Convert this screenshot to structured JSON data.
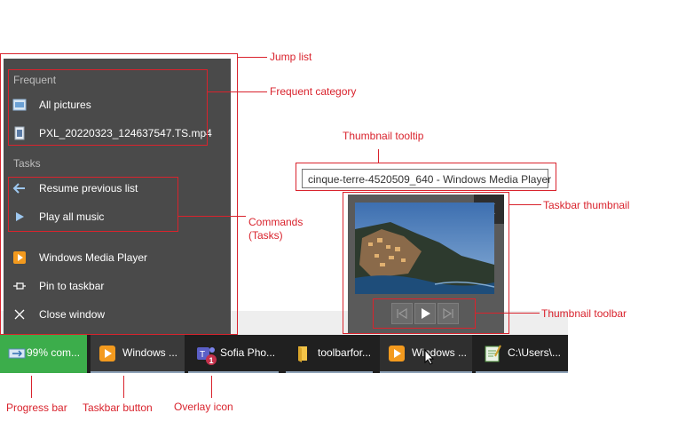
{
  "jump_list": {
    "frequent_header": "Frequent",
    "frequent_items": [
      {
        "label": "All pictures",
        "icon": "pictures-folder-icon"
      },
      {
        "label": "PXL_20220323_124637547.TS.mp4",
        "icon": "video-file-icon"
      }
    ],
    "tasks_header": "Tasks",
    "task_items": [
      {
        "label": "Resume previous list",
        "icon": "back-arrow-icon"
      },
      {
        "label": "Play all music",
        "icon": "play-icon"
      }
    ],
    "app_items": [
      {
        "label": "Windows Media Player",
        "icon": "media-player-icon"
      },
      {
        "label": "Pin to taskbar",
        "icon": "pin-icon"
      },
      {
        "label": "Close window",
        "icon": "close-icon"
      }
    ]
  },
  "tooltip": {
    "text": "cinque-terre-4520509_640 - Windows Media Player"
  },
  "thumbnail_toolbar": {
    "buttons": [
      "previous-icon",
      "play-icon",
      "next-icon"
    ]
  },
  "taskbar": {
    "buttons": [
      {
        "label": "99% com...",
        "icon": "transfer-icon",
        "progress": 0.99
      },
      {
        "label": "Windows ...",
        "icon": "media-player-icon"
      },
      {
        "label": "Sofia Pho...",
        "icon": "teams-icon",
        "overlay": "1"
      },
      {
        "label": "toolbarfor...",
        "icon": "folder-icon"
      },
      {
        "label": "Windows ...",
        "icon": "media-player-icon"
      },
      {
        "label": "C:\\Users\\...",
        "icon": "notepad-icon"
      }
    ]
  },
  "annotations": {
    "jump_list": "Jump list",
    "frequent_category": "Frequent category",
    "thumbnail_tooltip": "Thumbnail tooltip",
    "taskbar_thumbnail": "Taskbar thumbnail",
    "commands_tasks": "Commands (Tasks)",
    "thumbnail_toolbar": "Thumbnail toolbar",
    "progress_bar": "Progress bar",
    "taskbar_button": "Taskbar button",
    "overlay_icon": "Overlay icon"
  },
  "colors": {
    "annotation_red": "#d9232d",
    "progress_green": "#3cad4b",
    "taskbar_bg": "#202020",
    "jumplist_bg": "#4a4a4a"
  }
}
